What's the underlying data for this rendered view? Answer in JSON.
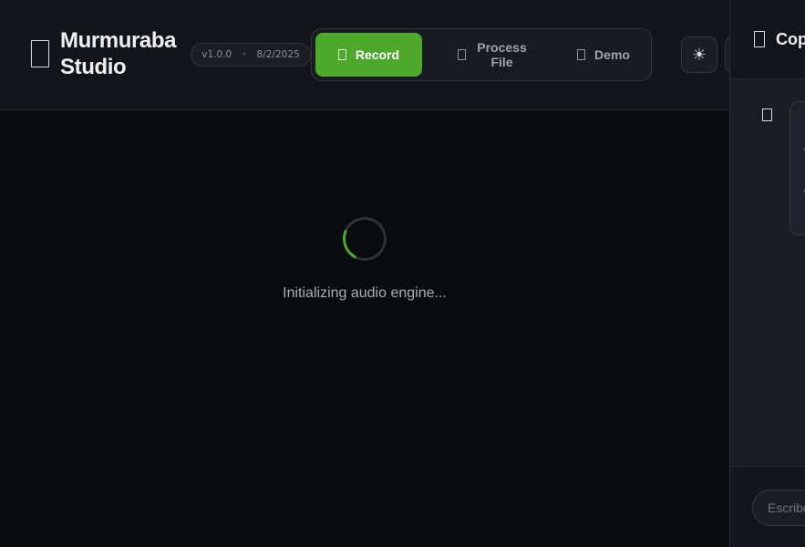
{
  "header": {
    "app_title": "Murmuraba Studio",
    "version": "v1.0.0",
    "separator": "•",
    "date": "8/2/2025",
    "theme_toggle_icon": "sun-icon",
    "tabs": [
      {
        "label": "Record",
        "icon": "record-icon",
        "active": true
      },
      {
        "label": "Process File",
        "icon": "file-icon",
        "active": false
      },
      {
        "label": "Demo",
        "icon": "demo-icon",
        "active": false
      }
    ]
  },
  "main": {
    "loading_text": "Initializing audio engine..."
  },
  "copilot": {
    "title": "Copilot",
    "input_placeholder": "Escribe..."
  },
  "colors": {
    "accent": "#4ea82c",
    "background": "#0a0b0e",
    "header_bg": "#14151a",
    "panel_bg": "#1b1c23"
  }
}
